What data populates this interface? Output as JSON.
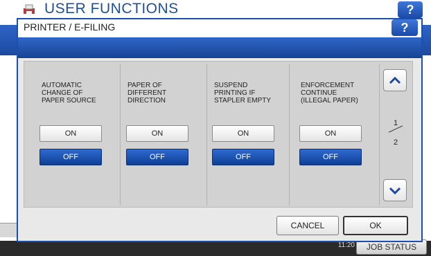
{
  "background": {
    "title": "USER FUNCTIONS",
    "help_label": "?",
    "clock": "11:20",
    "job_status_label": "JOB STATUS"
  },
  "dialog": {
    "title": "PRINTER / E-FILING",
    "help_label": "?",
    "settings": [
      {
        "label_lines": [
          "AUTOMATIC",
          "CHANGE OF",
          "PAPER SOURCE"
        ],
        "on_label": "ON",
        "off_label": "OFF",
        "selected": "OFF"
      },
      {
        "label_lines": [
          "PAPER OF",
          "DIFFERENT",
          "DIRECTION"
        ],
        "on_label": "ON",
        "off_label": "OFF",
        "selected": "OFF"
      },
      {
        "label_lines": [
          "SUSPEND",
          "PRINTING IF",
          "STAPLER EMPTY"
        ],
        "on_label": "ON",
        "off_label": "OFF",
        "selected": "OFF"
      },
      {
        "label_lines": [
          "ENFORCEMENT",
          "CONTINUE",
          "(ILLEGAL PAPER)"
        ],
        "on_label": "ON",
        "off_label": "OFF",
        "selected": "OFF"
      }
    ],
    "pagination": {
      "current": "1",
      "total": "2"
    },
    "scroll_up_icon": "chevron-up-icon",
    "scroll_down_icon": "chevron-down-icon",
    "cancel_label": "CANCEL",
    "ok_label": "OK"
  },
  "colors": {
    "accent_blue": "#1b4fae",
    "selected_button": "#1e55b8",
    "panel_gray": "#d2d2d2"
  }
}
